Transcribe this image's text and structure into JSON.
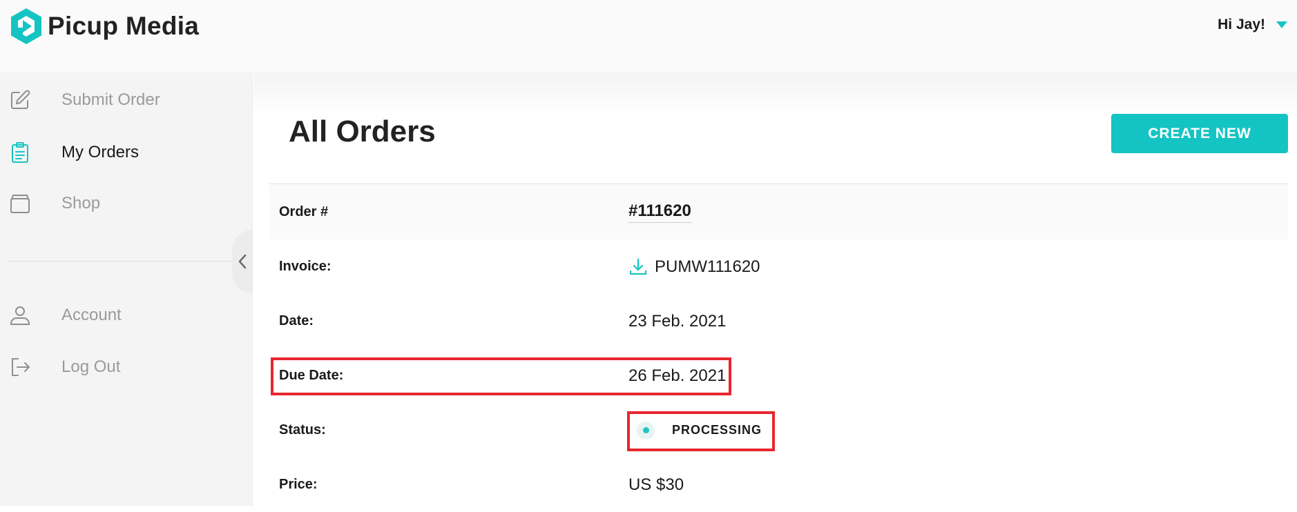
{
  "app": {
    "brand_name": "Picup Media",
    "brand_color": "#14c4c2"
  },
  "header": {
    "greeting": "Hi Jay!"
  },
  "sidebar": {
    "items": [
      {
        "label": "Submit Order",
        "icon": "edit-icon",
        "active": false
      },
      {
        "label": "My Orders",
        "icon": "clipboard-icon",
        "active": true
      },
      {
        "label": "Shop",
        "icon": "box-icon",
        "active": false
      },
      {
        "label": "Account",
        "icon": "user-icon",
        "active": false
      },
      {
        "label": "Log Out",
        "icon": "logout-icon",
        "active": false
      }
    ]
  },
  "main": {
    "title": "All Orders",
    "create_button_label": "CREATE NEW",
    "details": {
      "order_label": "Order #",
      "order_value": "#111620",
      "invoice_label": "Invoice:",
      "invoice_value": "PUMW111620",
      "date_label": "Date:",
      "date_value": "23 Feb. 2021",
      "due_date_label": "Due Date:",
      "due_date_value": "26 Feb. 2021",
      "status_label": "Status:",
      "status_value": "PROCESSING",
      "price_label": "Price:",
      "price_value": "US $30"
    }
  },
  "colors": {
    "accent": "#14c4c2",
    "highlight": "#e8262e"
  }
}
